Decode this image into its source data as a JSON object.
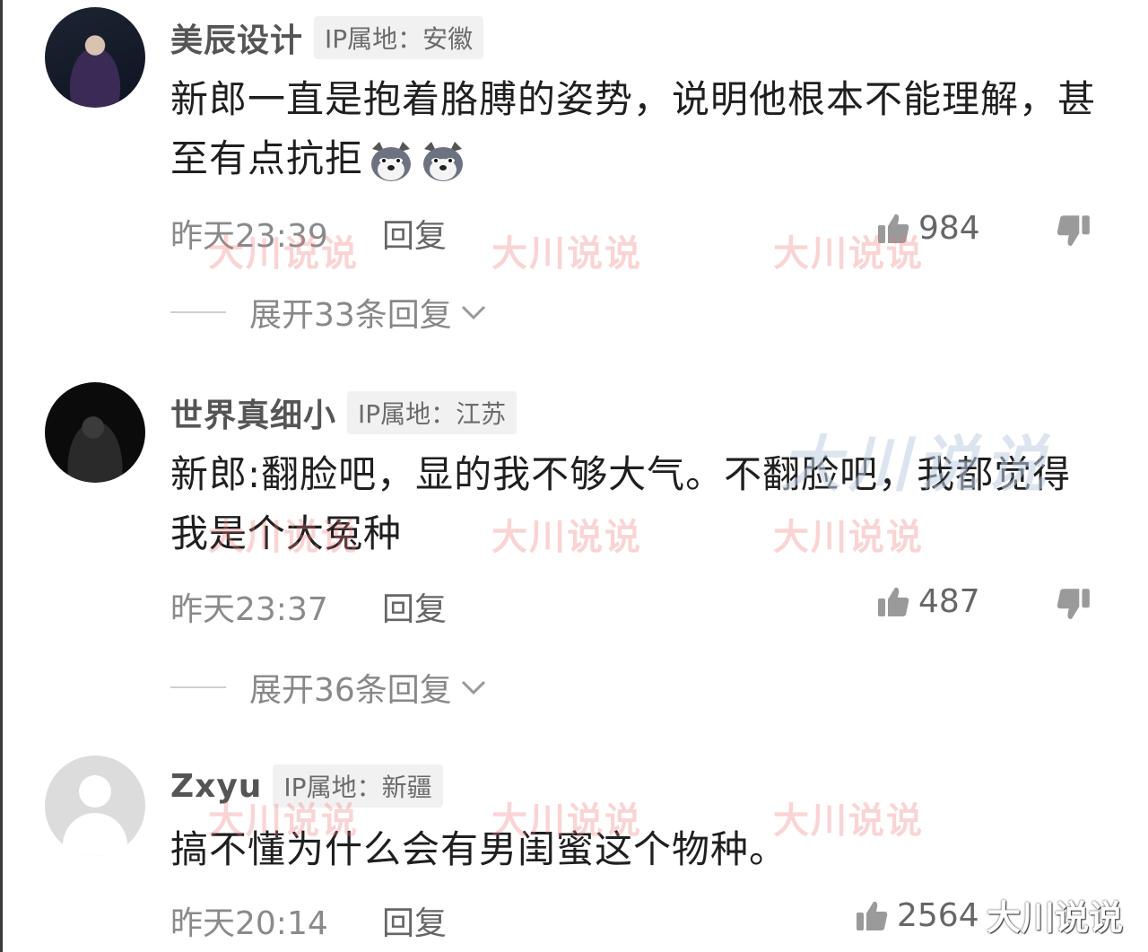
{
  "comments": [
    {
      "name": "美辰设计",
      "ip": "IP属地：安徽",
      "text": "新郎一直是抱着胳膊的姿势，说明他根本不能理解，甚至有点抗拒",
      "emoji": "dog-emoji",
      "time": "昨天23:39",
      "reply": "回复",
      "likes": "984",
      "expand": "展开33条回复"
    },
    {
      "name": "世界真细小",
      "ip": "IP属地：江苏",
      "text": "新郎:翻脸吧，显的我不够大气。不翻脸吧，我都觉得我是个大冤种",
      "time": "昨天23:37",
      "reply": "回复",
      "likes": "487",
      "expand": "展开36条回复"
    },
    {
      "name": "Zxyu",
      "ip": "IP属地：新疆",
      "text": "搞不懂为什么会有男闺蜜这个物种。",
      "time": "昨天20:14",
      "reply": "回复",
      "likes": "2564"
    }
  ],
  "watermark": "大川说说",
  "icons": {
    "like": "thumbs-up-icon",
    "dislike": "thumbs-down-icon",
    "expand": "chevron-down-icon"
  },
  "colors": {
    "text": "#1f1f1f",
    "meta": "#8a8a8a",
    "badge_bg": "#f1f1f1"
  }
}
